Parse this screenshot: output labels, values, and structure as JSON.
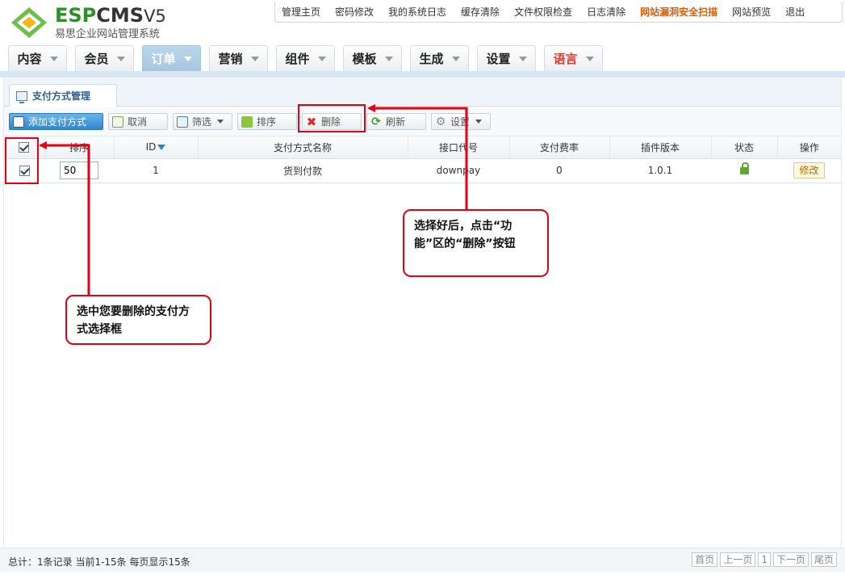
{
  "brand": {
    "name_green": "ESP",
    "name_dark": "CMS",
    "version": "V5",
    "subtitle": "易思企业网站管理系统"
  },
  "top_links": [
    "管理主页",
    "密码修改",
    "我的系统日志",
    "缓存清除",
    "文件权限检查",
    "日志清除",
    "网站漏洞安全扫描",
    "网站预览",
    "退出"
  ],
  "main_nav": [
    "内容",
    "会员",
    "订单",
    "营销",
    "组件",
    "模板",
    "生成",
    "设置",
    "语言"
  ],
  "tab": {
    "title": "支付方式管理"
  },
  "toolbar": {
    "add": "添加支付方式",
    "cancel": "取消",
    "filter": "筛选",
    "sort": "排序",
    "delete": "删除",
    "refresh": "刷新",
    "settings": "设置"
  },
  "table": {
    "headers": [
      "排序",
      "ID",
      "支付方式名称",
      "接口代号",
      "支付费率",
      "插件版本",
      "状态",
      "操作"
    ],
    "rows": [
      {
        "sort": "50",
        "id": "1",
        "name": "货到付款",
        "code": "downpay",
        "rate": "0",
        "version": "1.0.1",
        "action": "修改"
      }
    ]
  },
  "annotations": {
    "delete_tip": "选择好后，点击“功能”区的“删除”按钮",
    "select_tip": "选中您要删除的支付方式选择框"
  },
  "footer": {
    "status": "总计：1条记录 当前1-15条 每页显示15条",
    "pager": [
      "首页",
      "上一页",
      "1",
      "下一页",
      "尾页"
    ]
  },
  "colors": {
    "accent": "#2f86cf",
    "annotation": "#e60012",
    "alert_link": "#e05a00"
  }
}
